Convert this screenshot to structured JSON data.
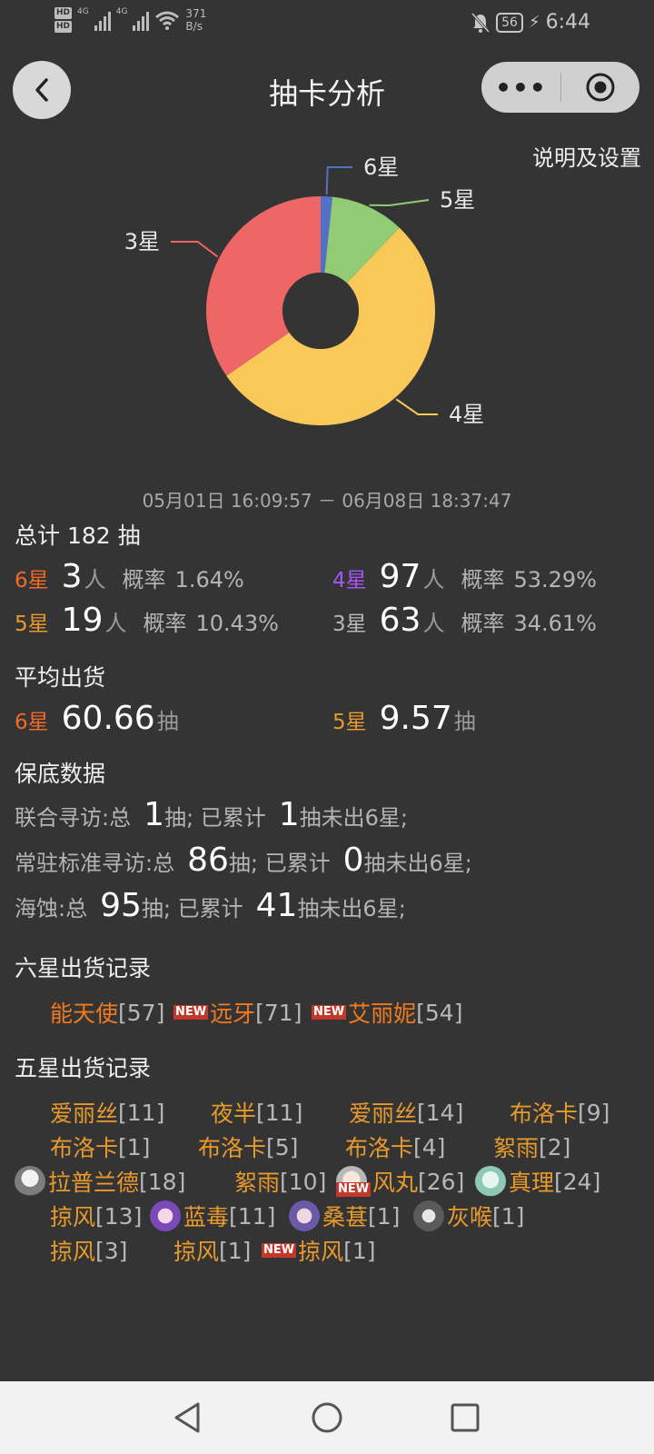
{
  "status_bar": {
    "hd1": "HD",
    "hd2": "HD",
    "net1": "4G",
    "net2": "4G",
    "speed_value": "371",
    "speed_unit": "B/s",
    "battery": "56",
    "time": "6:44"
  },
  "header": {
    "title": "抽卡分析",
    "more_icon": "more-dots-icon",
    "target_icon": "target-icon",
    "back_icon": "back-icon"
  },
  "settings_link": "说明及设置",
  "chart_data": {
    "type": "pie",
    "donut": true,
    "categories": [
      "6星",
      "5星",
      "4星",
      "3星"
    ],
    "values": [
      3,
      19,
      97,
      63
    ],
    "colors": [
      "#5470c6",
      "#91cc75",
      "#fac858",
      "#ee6666"
    ]
  },
  "date_range": "05月01日 16:09:57 － 06月08日 18:37:47",
  "total": {
    "label": "总计",
    "value": "182",
    "unit": "抽"
  },
  "stats": [
    {
      "star": "6星",
      "count": "3",
      "unit": "人",
      "prob_label": "概率",
      "prob": "1.64%"
    },
    {
      "star": "4星",
      "count": "97",
      "unit": "人",
      "prob_label": "概率",
      "prob": "53.29%"
    },
    {
      "star": "5星",
      "count": "19",
      "unit": "人",
      "prob_label": "概率",
      "prob": "10.43%"
    },
    {
      "star": "3星",
      "count": "63",
      "unit": "人",
      "prob_label": "概率",
      "prob": "34.61%"
    }
  ],
  "average": {
    "title": "平均出货",
    "items": [
      {
        "star": "6星",
        "value": "60.66",
        "unit": "抽"
      },
      {
        "star": "5星",
        "value": "9.57",
        "unit": "抽"
      }
    ]
  },
  "pity": {
    "title": "保底数据",
    "rows": [
      {
        "pool": "联合寻访:总",
        "total": "1",
        "mid": "抽; 已累计",
        "acc": "1",
        "tail": "抽未出6星;"
      },
      {
        "pool": "常驻标准寻访:总",
        "total": "86",
        "mid": "抽; 已累计",
        "acc": "0",
        "tail": "抽未出6星;"
      },
      {
        "pool": "海蚀:总",
        "total": "95",
        "mid": "抽; 已累计",
        "acc": "41",
        "tail": "抽未出6星;"
      }
    ]
  },
  "six_star_records": {
    "title": "六星出货记录",
    "new_tag": "NEW",
    "items": [
      {
        "name": "能天使",
        "count": "[57]"
      },
      {
        "name": "远牙",
        "count": "[71]"
      },
      {
        "name": "艾丽妮",
        "count": "[54]"
      }
    ]
  },
  "five_star_records": {
    "title": "五星出货记录",
    "new_tag": "NEW",
    "items": [
      {
        "name": "爱丽丝",
        "count": "[11]"
      },
      {
        "name": "夜半",
        "count": "[11]"
      },
      {
        "name": "爱丽丝",
        "count": "[14]"
      },
      {
        "name": "布洛卡",
        "count": "[9]"
      },
      {
        "name": "布洛卡",
        "count": "[1]"
      },
      {
        "name": "布洛卡",
        "count": "[5]"
      },
      {
        "name": "布洛卡",
        "count": "[4]"
      },
      {
        "name": "絮雨",
        "count": "[2]"
      },
      {
        "name": "拉普兰德",
        "count": "[18]"
      },
      {
        "name": "絮雨",
        "count": "[10]"
      },
      {
        "name": "风丸",
        "count": "[26]"
      },
      {
        "name": "真理",
        "count": "[24]"
      },
      {
        "name": "掠风",
        "count": "[13]"
      },
      {
        "name": "蓝毒",
        "count": "[11]"
      },
      {
        "name": "桑葚",
        "count": "[1]"
      },
      {
        "name": "灰喉",
        "count": "[1]"
      },
      {
        "name": "掠风",
        "count": "[3]"
      },
      {
        "name": "掠风",
        "count": "[1]"
      },
      {
        "name": "掠风",
        "count": "[1]"
      }
    ]
  },
  "system_nav": {
    "back": "triangle-back-icon",
    "home": "circle-home-icon",
    "recents": "square-recents-icon"
  }
}
